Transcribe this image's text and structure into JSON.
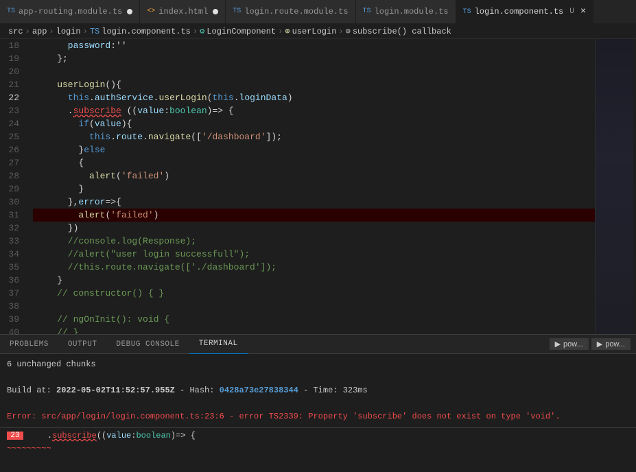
{
  "tabs": [
    {
      "id": "app-routing",
      "prefix": "TS",
      "label": "app-routing.module.ts",
      "modified": true,
      "active": false
    },
    {
      "id": "index-html",
      "prefix": "<>",
      "label": "index.html",
      "modified": true,
      "active": false
    },
    {
      "id": "login-route",
      "prefix": "TS",
      "label": "login.route.module.ts",
      "modified": false,
      "active": false
    },
    {
      "id": "login-module",
      "prefix": "TS",
      "label": "login.module.ts",
      "modified": false,
      "active": false
    },
    {
      "id": "login-component",
      "prefix": "TS",
      "label": "login.component.ts",
      "modified": false,
      "active": true,
      "closeable": true
    }
  ],
  "breadcrumb": {
    "parts": [
      "src",
      "app",
      "login",
      "TS login.component.ts",
      "LoginComponent",
      "userLogin",
      "subscribe() callback"
    ]
  },
  "lines": [
    {
      "num": 18,
      "code": "      password:''",
      "active": false
    },
    {
      "num": 19,
      "code": "    };",
      "active": false
    },
    {
      "num": 20,
      "code": "",
      "active": false
    },
    {
      "num": 21,
      "code": "    userLogin(){",
      "active": false
    },
    {
      "num": 22,
      "code": "      this.authService.userLogin(this.loginData)",
      "active": true,
      "hasRedDot": true
    },
    {
      "num": 23,
      "code": "      .subscribe ((value:boolean)=> {",
      "active": false
    },
    {
      "num": 24,
      "code": "        if(value){",
      "active": false
    },
    {
      "num": 25,
      "code": "          this.route.navigate(['/dashboard']);",
      "active": false
    },
    {
      "num": 26,
      "code": "        }else",
      "active": false
    },
    {
      "num": 27,
      "code": "        {",
      "active": false
    },
    {
      "num": 28,
      "code": "          alert('failed')",
      "active": false
    },
    {
      "num": 29,
      "code": "        }",
      "active": false
    },
    {
      "num": 30,
      "code": "      },error=>{",
      "active": false
    },
    {
      "num": 31,
      "code": "        alert('failed')",
      "active": false,
      "highlighted": true
    },
    {
      "num": 32,
      "code": "      })",
      "active": false
    },
    {
      "num": 33,
      "code": "      //console.log(Response);",
      "active": false
    },
    {
      "num": 34,
      "code": "      //alert(\"user login successfull\");",
      "active": false
    },
    {
      "num": 35,
      "code": "      //this.route.navigate(['./dashboard']);",
      "active": false
    },
    {
      "num": 36,
      "code": "    }",
      "active": false
    },
    {
      "num": 37,
      "code": "    // constructor() { }",
      "active": false
    },
    {
      "num": 38,
      "code": "",
      "active": false
    },
    {
      "num": 39,
      "code": "    // ngOnInit(): void {",
      "active": false
    },
    {
      "num": 40,
      "code": "    // }",
      "active": false
    }
  ],
  "panel": {
    "tabs": [
      {
        "label": "PROBLEMS",
        "active": false
      },
      {
        "label": "OUTPUT",
        "active": false
      },
      {
        "label": "DEBUG CONSOLE",
        "active": false
      },
      {
        "label": "TERMINAL",
        "active": true
      }
    ],
    "terminal_lines": [
      {
        "text": "6 unchanged chunks",
        "type": "normal"
      },
      {
        "text": "",
        "type": "normal"
      },
      {
        "text": "Build at: 2022-05-02T11:52:57.955Z - Hash: 0428a73e27838344 - Time: 323ms",
        "type": "build"
      },
      {
        "text": "",
        "type": "normal"
      },
      {
        "text": "Error: src/app/login/login.component.ts:23:6 - error TS2339: Property 'subscribe' does not exist on type 'void'.",
        "type": "error"
      }
    ],
    "right_buttons": [
      "powershell",
      "powershell"
    ],
    "bottom_code": "    .subscribe((value:boolean)=> {"
  }
}
